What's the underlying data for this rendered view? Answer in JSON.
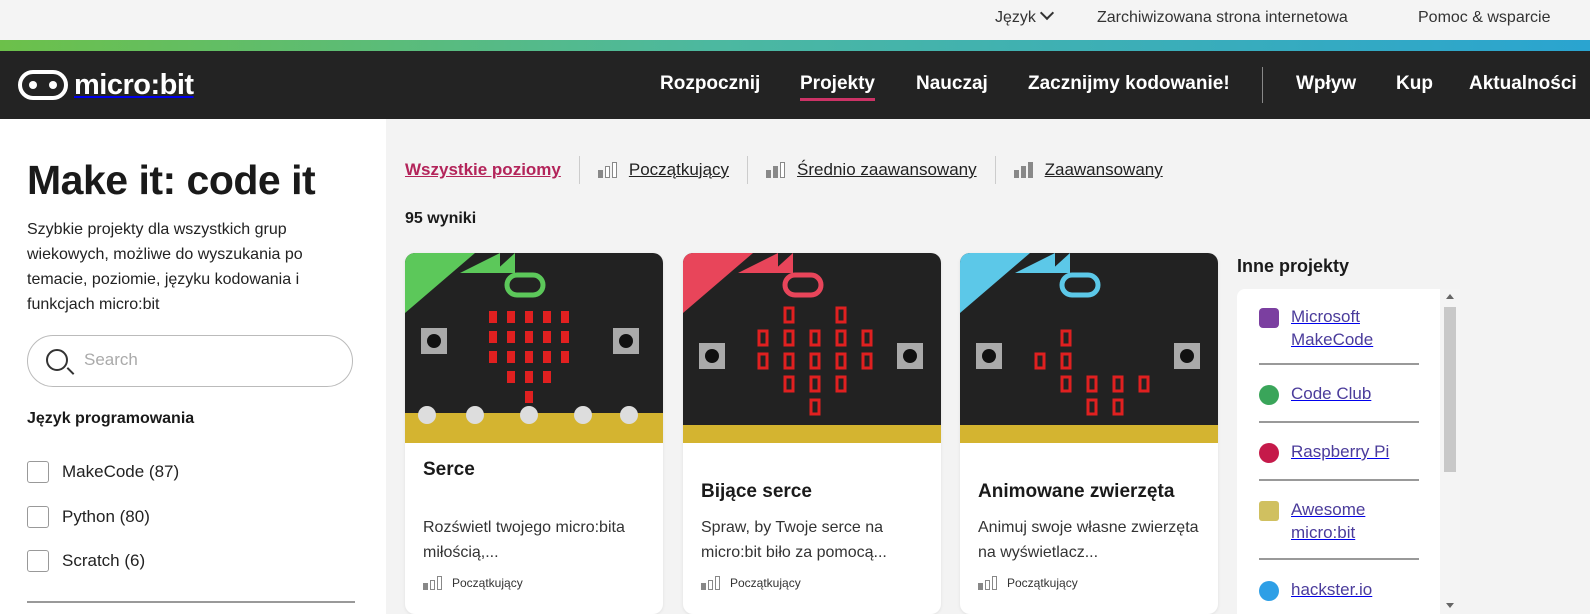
{
  "utility": {
    "language": "Język",
    "archived": "Zarchiwizowana strona internetowa",
    "help": "Pomoc & wsparcie"
  },
  "brand": {
    "logo_text": "micro:bit"
  },
  "nav": {
    "items": [
      "Rozpocznij",
      "Projekty",
      "Nauczaj",
      "Zacznijmy kodowanie!"
    ],
    "items_right": [
      "Wpływ",
      "Kup",
      "Aktualności"
    ],
    "active": "Projekty"
  },
  "sidebar": {
    "title": "Make it: code it",
    "description": "Szybkie projekty dla wszystkich grup wiekowych, możliwe do wyszukania po temacie, poziomie, języku kodowania i funkcjach micro:bit",
    "search_placeholder": "Search",
    "group_label": "Język programowania",
    "languages": [
      {
        "label": "MakeCode (87)",
        "checked": false
      },
      {
        "label": "Python (80)",
        "checked": false
      },
      {
        "label": "Scratch (6)",
        "checked": false
      }
    ]
  },
  "filters": {
    "all": "Wszystkie poziomy",
    "levels": [
      {
        "label": "Początkujący",
        "bars": 1
      },
      {
        "label": "Średnio zaawansowany",
        "bars": 2
      },
      {
        "label": "Zaawansowany",
        "bars": 3
      }
    ]
  },
  "results": "95 wyniki",
  "cards": [
    {
      "title": "Serce",
      "text": "Rozświetl twojego micro:bita miłością,...",
      "level": "Początkujący",
      "accent": "#5cc85a"
    },
    {
      "title": "Bijące serce",
      "text": "Spraw, by Twoje serce na micro:bit biło za pomocą...",
      "level": "Początkujący",
      "accent": "#e8455a"
    },
    {
      "title": "Animowane zwierzęta",
      "text": "Animuj swoje własne zwierzęta na wyświetlacz...",
      "level": "Początkujący",
      "accent": "#5cc8e8"
    }
  ],
  "other": {
    "heading": "Inne projekty",
    "items": [
      {
        "label": "Microsoft MakeCode",
        "icon": "makecode-icon",
        "color": "#7b3fa0"
      },
      {
        "label": "Code Club",
        "icon": "code-club-icon",
        "color": "#3aa55a"
      },
      {
        "label": "Raspberry Pi",
        "icon": "raspberry-pi-icon",
        "color": "#c51a4a"
      },
      {
        "label": "Awesome micro:bit",
        "icon": "awesome-microbit-icon",
        "color": "#d0c060"
      },
      {
        "label": "hackster.io",
        "icon": "hackster-icon",
        "color": "#2e9fe6"
      }
    ]
  }
}
